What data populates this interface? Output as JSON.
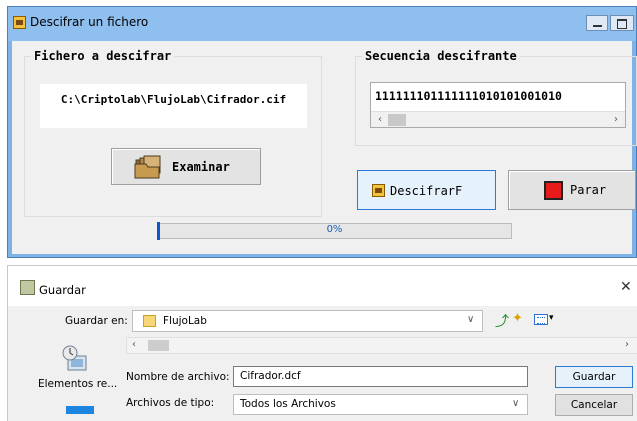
{
  "main_window": {
    "title": "Descifrar un fichero",
    "file_group": {
      "title": "Fichero a descifrar",
      "path": "C:\\Criptolab\\FlujoLab\\Cifrador.cif",
      "browse_label": "Examinar"
    },
    "sequence_group": {
      "title": "Secuencia descifrante",
      "value": "111111101111111010101001010"
    },
    "decrypt_label": "DescifrarF",
    "stop_label": "Parar",
    "progress": {
      "value": 0,
      "text": "0%"
    }
  },
  "save_dialog": {
    "title": "Guardar",
    "look_in_label": "Guardar en:",
    "look_in_value": "FlujoLab",
    "places": [
      {
        "label": "Elementos re..."
      }
    ],
    "filename_label": "Nombre de archivo:",
    "filename_value": "Cifrador.dcf",
    "filetype_label": "Archivos de tipo:",
    "filetype_value": "Todos los Archivos",
    "save_label": "Guardar",
    "cancel_label": "Cancelar"
  },
  "colors": {
    "title_bar": "#8fbfee",
    "accent_border": "#2b7ad6",
    "stop_red": "#e81b1b",
    "progress_fill": "#06b025"
  }
}
